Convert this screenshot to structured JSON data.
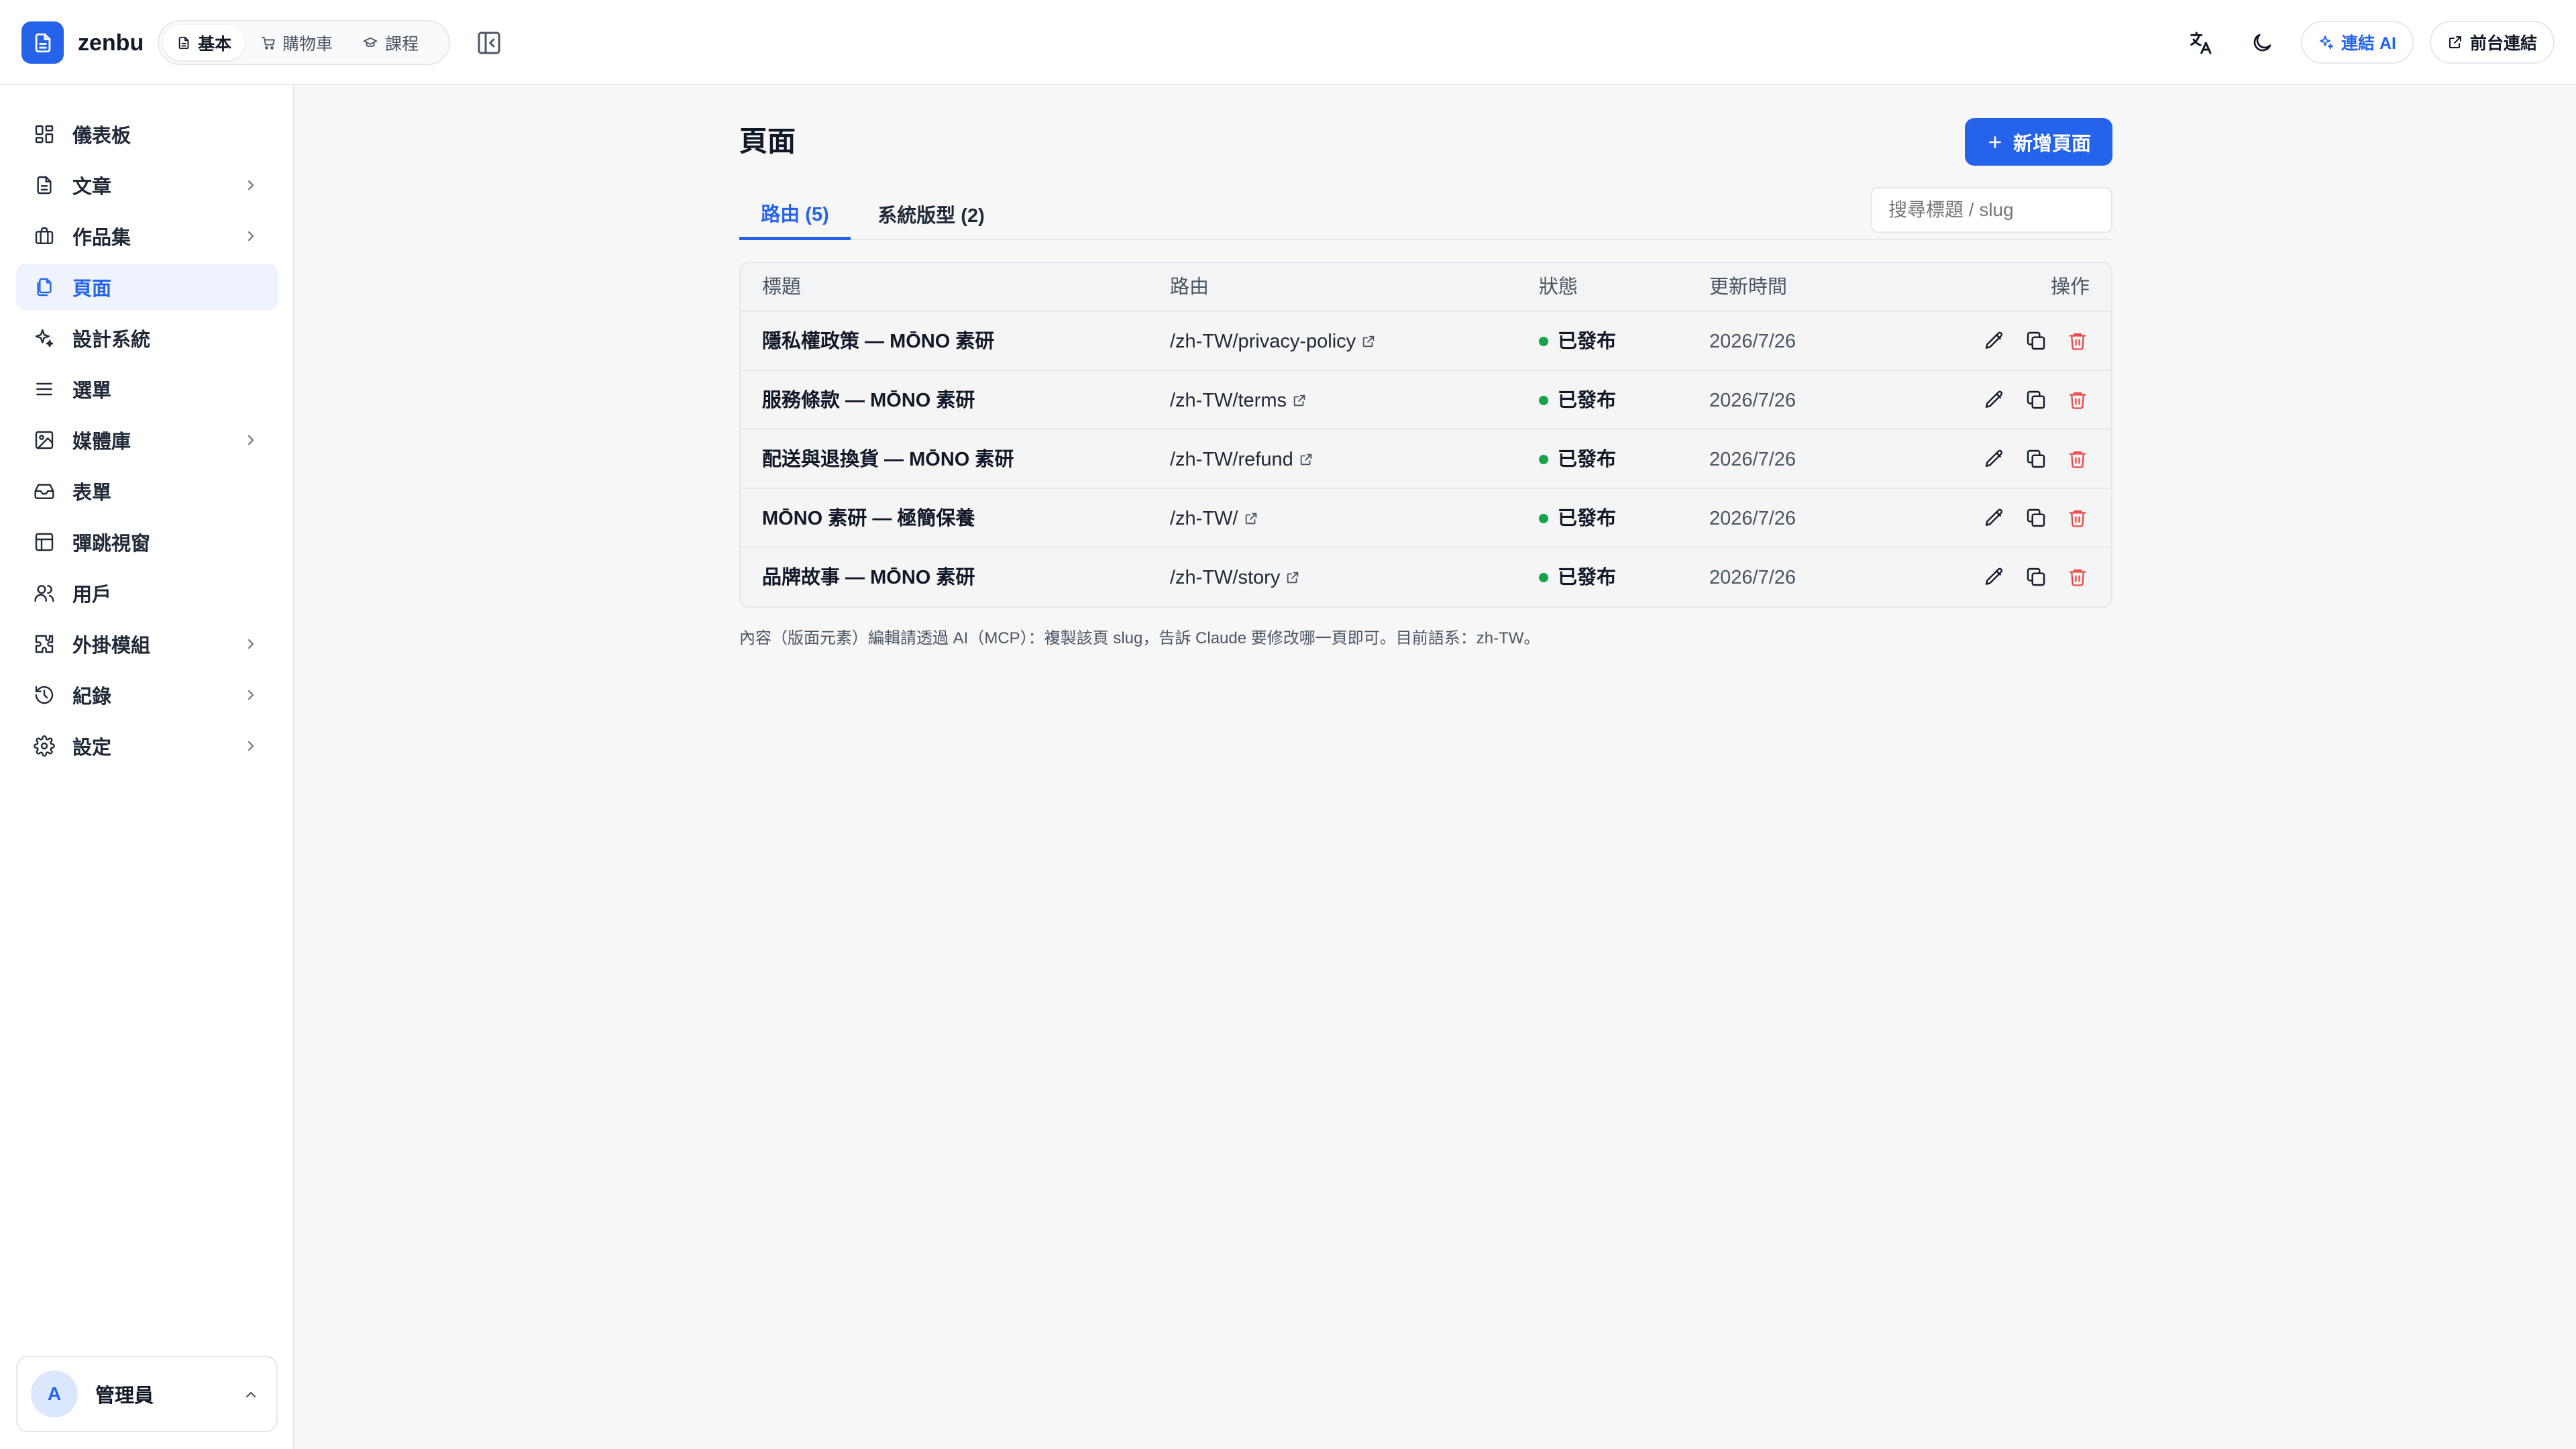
{
  "app": {
    "brand": "zenbu",
    "modes": [
      {
        "label": "基本",
        "icon": "document-icon",
        "active": true
      },
      {
        "label": "購物車",
        "icon": "cart-icon",
        "active": false
      },
      {
        "label": "課程",
        "icon": "graduation-cap-icon",
        "active": false
      }
    ],
    "connect_ai_label": "連結 AI",
    "frontend_link_label": "前台連結"
  },
  "sidebar": {
    "items": [
      {
        "label": "儀表板",
        "icon": "dashboard-icon",
        "has_children": false,
        "active": false
      },
      {
        "label": "文章",
        "icon": "document-icon",
        "has_children": true,
        "active": false
      },
      {
        "label": "作品集",
        "icon": "briefcase-icon",
        "has_children": true,
        "active": false
      },
      {
        "label": "頁面",
        "icon": "pages-icon",
        "has_children": false,
        "active": true
      },
      {
        "label": "設計系統",
        "icon": "sparkles-icon",
        "has_children": false,
        "active": false
      },
      {
        "label": "選單",
        "icon": "menu-icon",
        "has_children": false,
        "active": false
      },
      {
        "label": "媒體庫",
        "icon": "image-icon",
        "has_children": true,
        "active": false
      },
      {
        "label": "表單",
        "icon": "inbox-icon",
        "has_children": false,
        "active": false
      },
      {
        "label": "彈跳視窗",
        "icon": "window-icon",
        "has_children": false,
        "active": false
      },
      {
        "label": "用戶",
        "icon": "users-icon",
        "has_children": false,
        "active": false
      },
      {
        "label": "外掛模組",
        "icon": "puzzle-icon",
        "has_children": true,
        "active": false
      },
      {
        "label": "紀錄",
        "icon": "history-icon",
        "has_children": true,
        "active": false
      },
      {
        "label": "設定",
        "icon": "gear-icon",
        "has_children": true,
        "active": false
      }
    ],
    "user": {
      "initial": "A",
      "name": "管理員"
    }
  },
  "main": {
    "title": "頁面",
    "new_button_label": "新增頁面",
    "tabs": [
      {
        "label": "路由 (5)",
        "active": true
      },
      {
        "label": "系統版型 (2)",
        "active": false
      }
    ],
    "search_placeholder": "搜尋標題 / slug",
    "table": {
      "headers": {
        "title": "標題",
        "route": "路由",
        "status": "狀態",
        "updated": "更新時間",
        "actions": "操作"
      },
      "rows": [
        {
          "title": "隱私權政策 — MŌNO 素研",
          "route": "/zh-TW/privacy-policy",
          "status": "已發布",
          "updated": "2026/7/26"
        },
        {
          "title": "服務條款 — MŌNO 素研",
          "route": "/zh-TW/terms",
          "status": "已發布",
          "updated": "2026/7/26"
        },
        {
          "title": "配送與退換貨 — MŌNO 素研",
          "route": "/zh-TW/refund",
          "status": "已發布",
          "updated": "2026/7/26"
        },
        {
          "title": "MŌNO 素研 — 極簡保養",
          "route": "/zh-TW/",
          "status": "已發布",
          "updated": "2026/7/26"
        },
        {
          "title": "品牌故事 — MŌNO 素研",
          "route": "/zh-TW/story",
          "status": "已發布",
          "updated": "2026/7/26"
        }
      ]
    },
    "footnote": "內容（版面元素）編輯請透過 AI（MCP）：複製該頁 slug，告訴 Claude 要修改哪一頁即可。目前語系：zh-TW。"
  },
  "colors": {
    "accent": "#2563eb",
    "published": "#16a34a",
    "danger": "#ef4444"
  }
}
